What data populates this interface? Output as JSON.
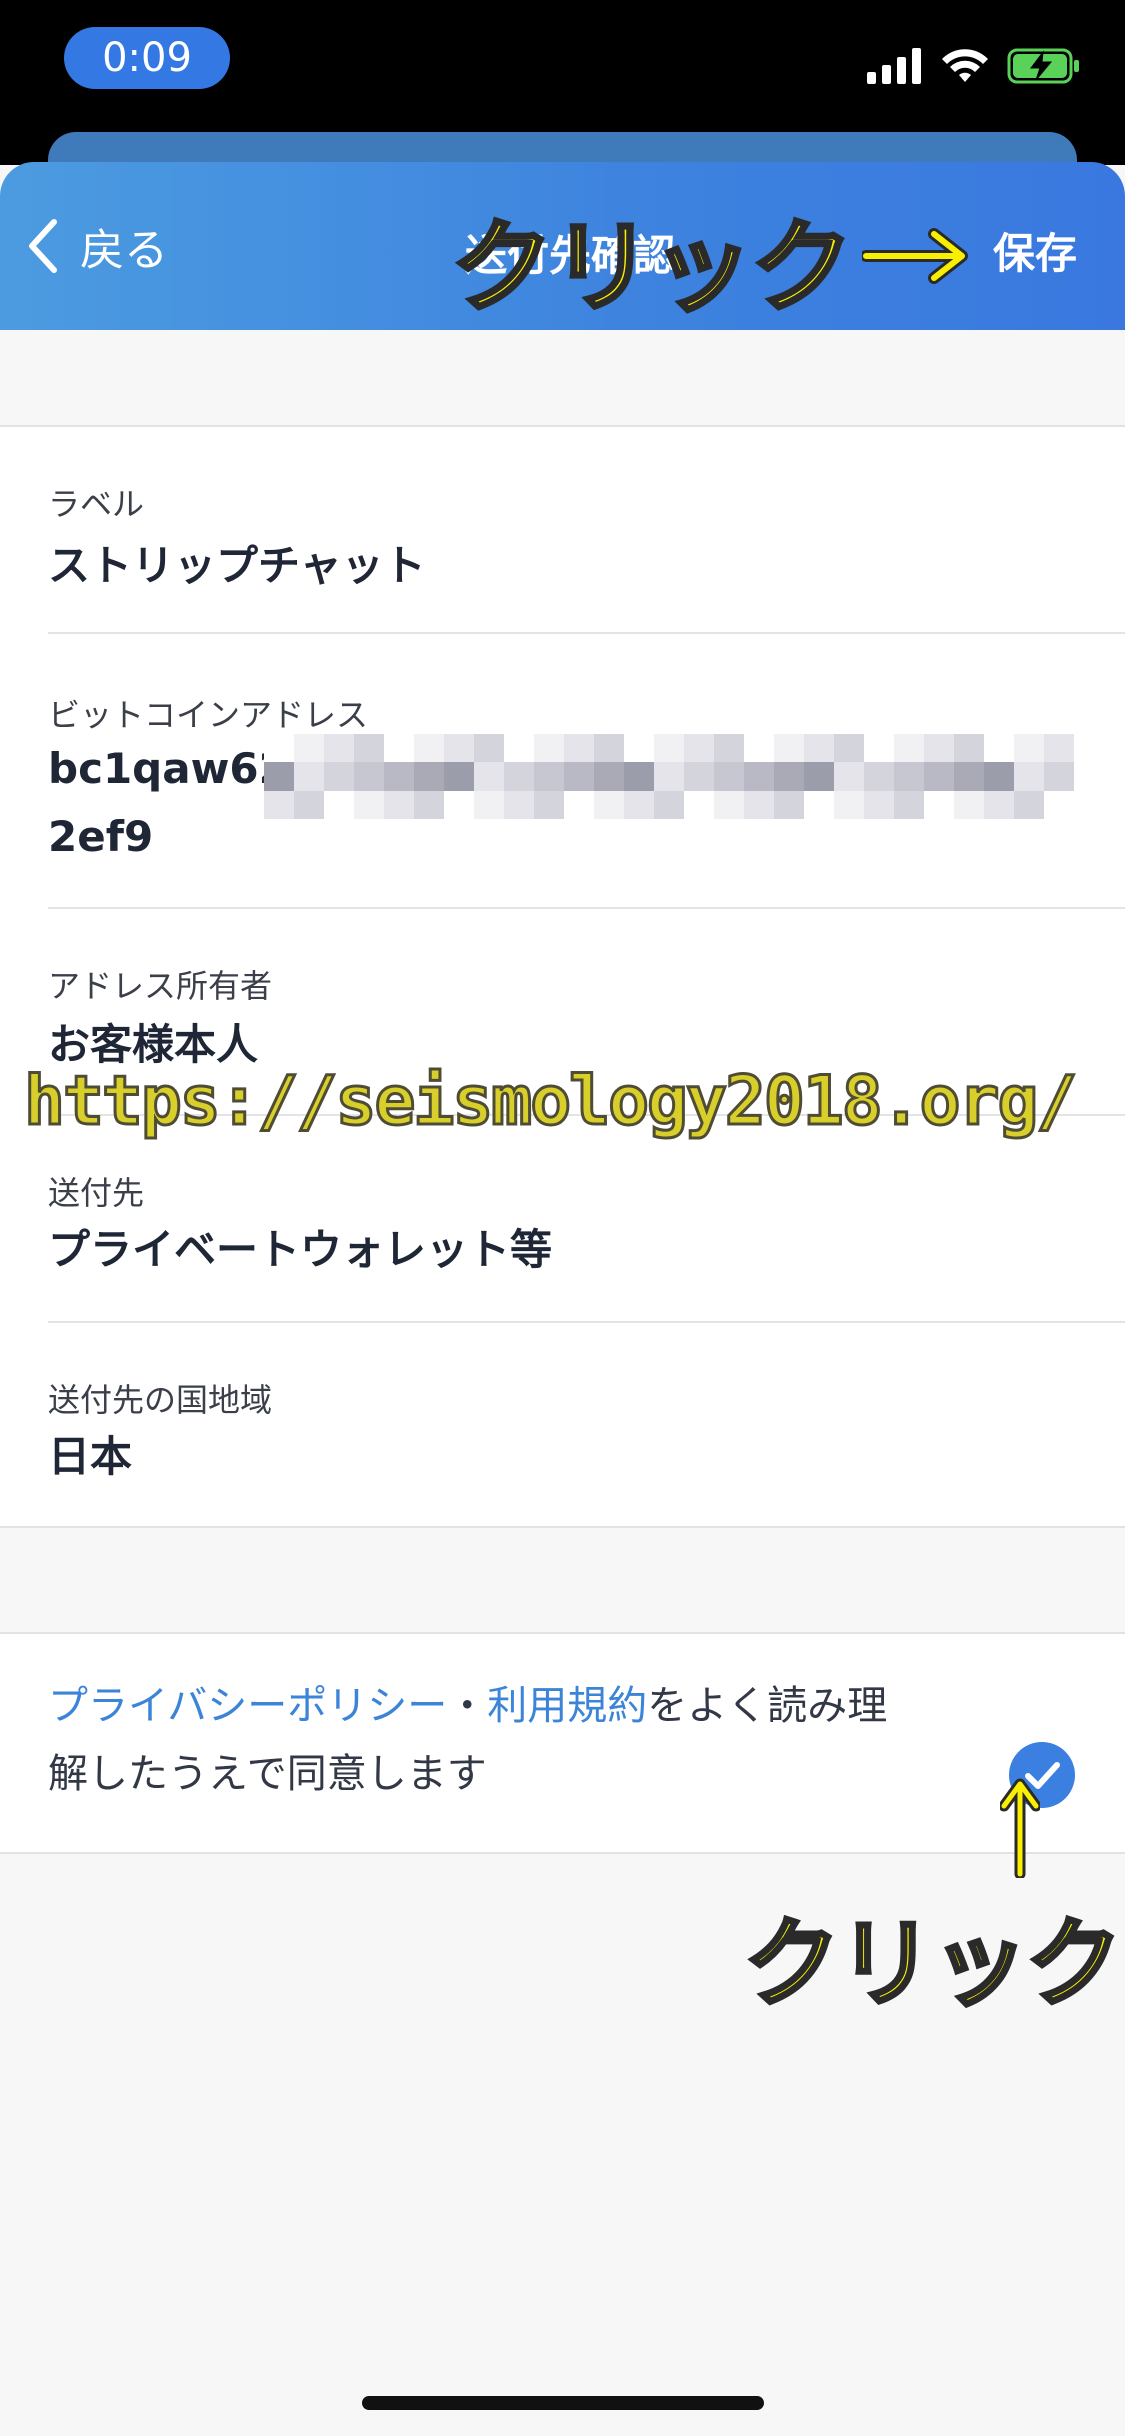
{
  "status_bar": {
    "time": "0:09"
  },
  "nav": {
    "back_label": "戻る",
    "title": "送付先確認",
    "save_label": "保存"
  },
  "annotations": {
    "top": "クリック",
    "bottom": "クリック",
    "watermark": "https://seismology2018.org/"
  },
  "form": {
    "label": {
      "title": "ラベル",
      "value": "ストリップチャット"
    },
    "address": {
      "title": "ビットコインアドレス",
      "value_visible_start": "bc1qaw62",
      "value_visible_end": "2ef9"
    },
    "owner": {
      "title": "アドレス所有者",
      "value": "お客様本人"
    },
    "destination": {
      "title": "送付先",
      "value": "プライベートウォレット等"
    },
    "country": {
      "title": "送付先の国地域",
      "value": "日本"
    }
  },
  "agreement": {
    "privacy_link": "プライバシーポリシー",
    "separator": "・",
    "terms_link": "利用規約",
    "text_line1_rest": "をよく読み理",
    "text_line2": "解したうえで同意します",
    "checked": true,
    "check_color": "#3b80e0"
  },
  "colors": {
    "nav_gradient_start": "#4c9be0",
    "nav_gradient_end": "#3a78df",
    "link": "#3c84d8",
    "annotation_yellow": "#f8f000"
  }
}
